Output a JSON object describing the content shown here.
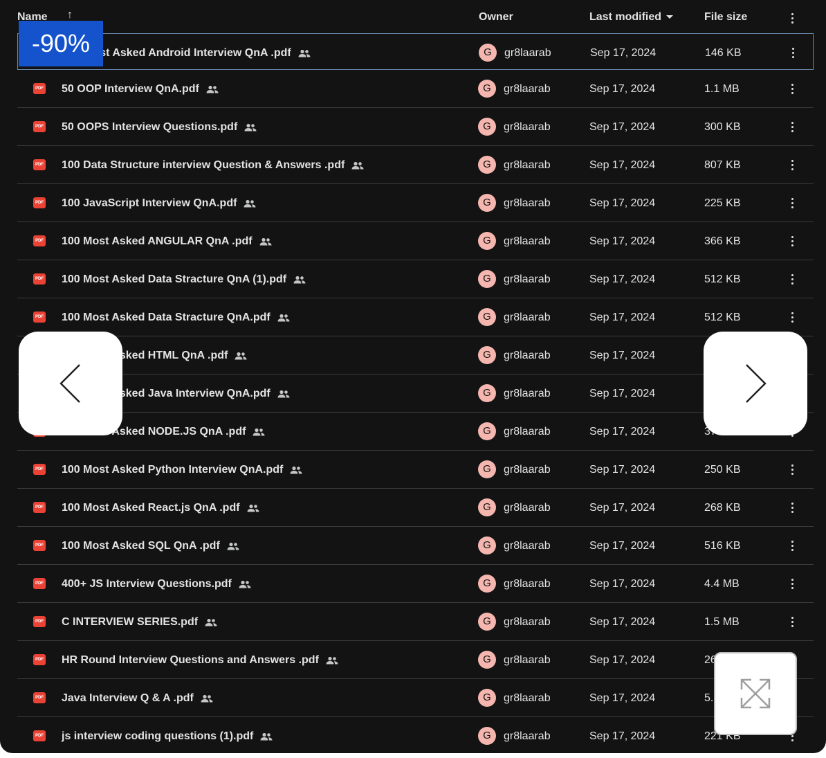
{
  "header": {
    "name": "Name",
    "sort_arrow": "↑",
    "owner": "Owner",
    "last_modified": "Last modified",
    "file_size": "File size"
  },
  "icons": {
    "file": "pdf-icon",
    "file_label": "PDF",
    "shared": "shared-people-icon",
    "more": "more-vert-icon"
  },
  "files": [
    {
      "name": "100 Most Asked Android Interview QnA .pdf",
      "owner_initial": "G",
      "owner": "gr8laarab",
      "modified": "Sep 17, 2024",
      "size": "146 KB"
    },
    {
      "name": "50 OOP Interview QnA.pdf",
      "owner_initial": "G",
      "owner": "gr8laarab",
      "modified": "Sep 17, 2024",
      "size": "1.1 MB"
    },
    {
      "name": "50 OOPS Interview Questions.pdf",
      "owner_initial": "G",
      "owner": "gr8laarab",
      "modified": "Sep 17, 2024",
      "size": "300 KB"
    },
    {
      "name": "100 Data Structure interview Question & Answers .pdf",
      "owner_initial": "G",
      "owner": "gr8laarab",
      "modified": "Sep 17, 2024",
      "size": "807 KB"
    },
    {
      "name": "100 JavaScript Interview QnA.pdf",
      "owner_initial": "G",
      "owner": "gr8laarab",
      "modified": "Sep 17, 2024",
      "size": "225 KB"
    },
    {
      "name": "100 Most Asked ANGULAR  QnA .pdf",
      "owner_initial": "G",
      "owner": "gr8laarab",
      "modified": "Sep 17, 2024",
      "size": "366 KB"
    },
    {
      "name": "100 Most Asked Data Stracture QnA (1).pdf",
      "owner_initial": "G",
      "owner": "gr8laarab",
      "modified": "Sep 17, 2024",
      "size": "512 KB"
    },
    {
      "name": "100 Most Asked Data Stracture QnA.pdf",
      "owner_initial": "G",
      "owner": "gr8laarab",
      "modified": "Sep 17, 2024",
      "size": "512 KB"
    },
    {
      "name": "100 Most Asked HTML  QnA .pdf",
      "owner_initial": "G",
      "owner": "gr8laarab",
      "modified": "Sep 17, 2024",
      "size": ""
    },
    {
      "name": "100 Most Asked Java Interview QnA.pdf",
      "owner_initial": "G",
      "owner": "gr8laarab",
      "modified": "Sep 17, 2024",
      "size": ""
    },
    {
      "name": "100 Most Asked NODE.JS  QnA .pdf",
      "owner_initial": "G",
      "owner": "gr8laarab",
      "modified": "Sep 17, 2024",
      "size": "378 KB"
    },
    {
      "name": "100 Most Asked Python Interview QnA.pdf",
      "owner_initial": "G",
      "owner": "gr8laarab",
      "modified": "Sep 17, 2024",
      "size": "250 KB"
    },
    {
      "name": "100 Most Asked React.js  QnA .pdf",
      "owner_initial": "G",
      "owner": "gr8laarab",
      "modified": "Sep 17, 2024",
      "size": "268 KB"
    },
    {
      "name": "100 Most Asked SQL  QnA .pdf",
      "owner_initial": "G",
      "owner": "gr8laarab",
      "modified": "Sep 17, 2024",
      "size": "516 KB"
    },
    {
      "name": "400+ JS Interview Questions.pdf",
      "owner_initial": "G",
      "owner": "gr8laarab",
      "modified": "Sep 17, 2024",
      "size": "4.4 MB"
    },
    {
      "name": "C INTERVIEW SERIES.pdf",
      "owner_initial": "G",
      "owner": "gr8laarab",
      "modified": "Sep 17, 2024",
      "size": "1.5 MB"
    },
    {
      "name": "HR Round Interview Questions and Answers .pdf",
      "owner_initial": "G",
      "owner": "gr8laarab",
      "modified": "Sep 17, 2024",
      "size": "26"
    },
    {
      "name": "Java Interview Q & A .pdf",
      "owner_initial": "G",
      "owner": "gr8laarab",
      "modified": "Sep 17, 2024",
      "size": "5."
    },
    {
      "name": "js interview coding questions (1).pdf",
      "owner_initial": "G",
      "owner": "gr8laarab",
      "modified": "Sep 17, 2024",
      "size": "221 KB"
    }
  ],
  "overlay": {
    "zoom_label": "-90%",
    "prev_icon": "chevron-left-icon",
    "next_icon": "chevron-right-icon",
    "expand_icon": "expand-arrows-icon"
  }
}
